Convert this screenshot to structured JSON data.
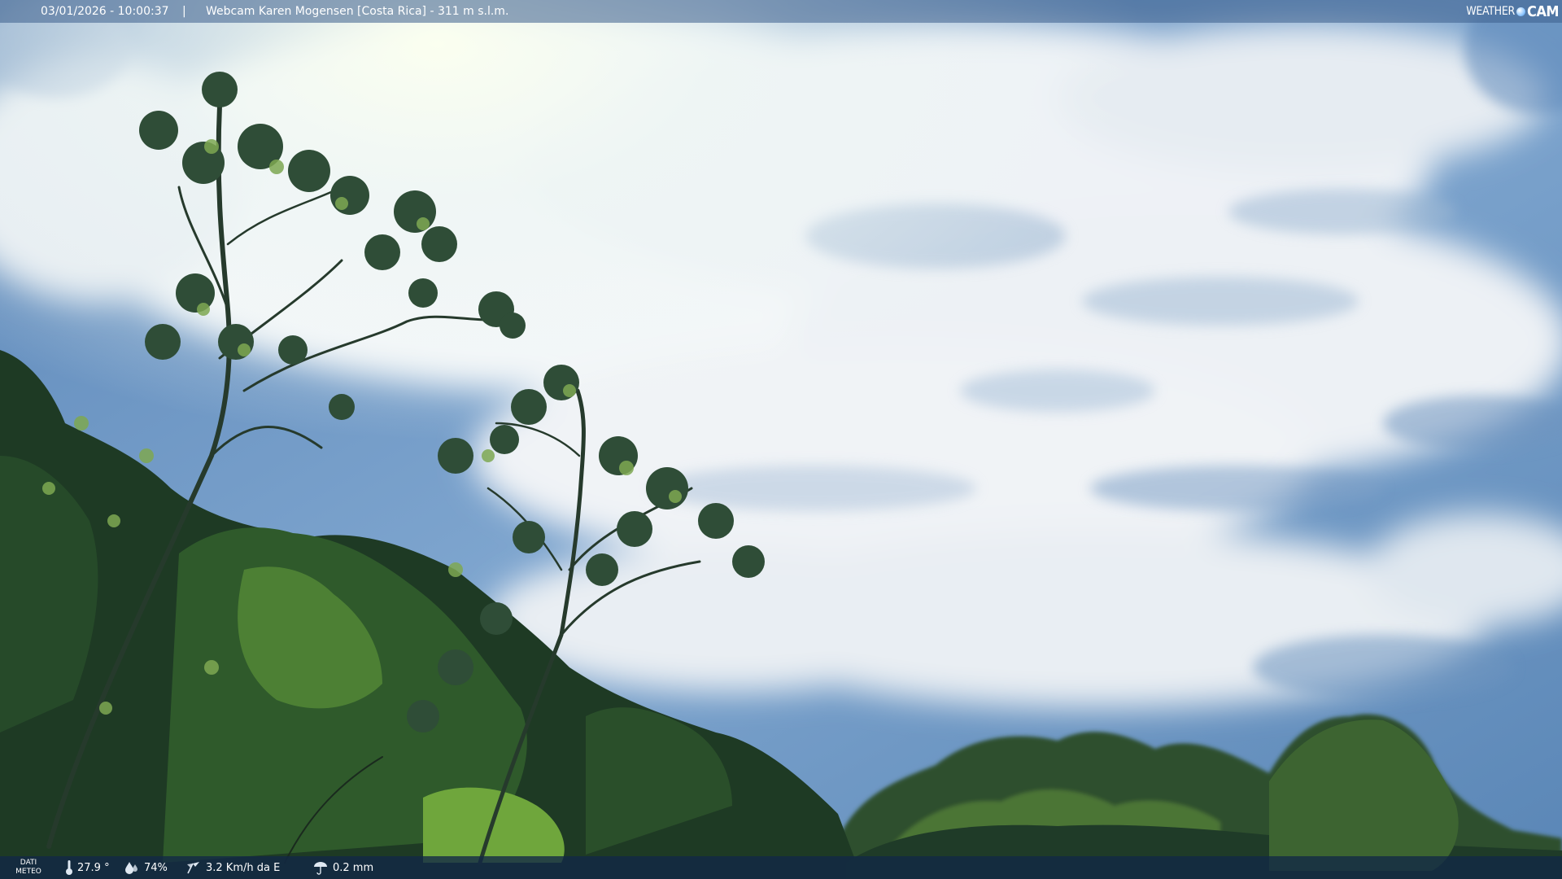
{
  "overlay": {
    "timestamp": "03/01/2026 - 10:00:37",
    "separator": "|",
    "camera_label": "Webcam Karen Mogensen [Costa Rica] - 311 m s.l.m.",
    "brand_weather": "WEATHER",
    "brand_cam": "CAM"
  },
  "weather": {
    "section_label_line1": "DATI",
    "section_label_line2": "METEO",
    "temperature": "27.9 °",
    "humidity": "74%",
    "wind": "3.2 Km/h da E",
    "rain": "0.2 mm"
  },
  "colors": {
    "sky_top": "#4d79ad",
    "cloud": "#f2f5f8",
    "foliage_dark": "#1c3a24",
    "foliage_mid": "#3f6a2c",
    "foliage_light": "#8cb64a"
  },
  "icons": [
    "thermometer-icon",
    "humidity-icon",
    "wind-icon",
    "rain-icon"
  ]
}
